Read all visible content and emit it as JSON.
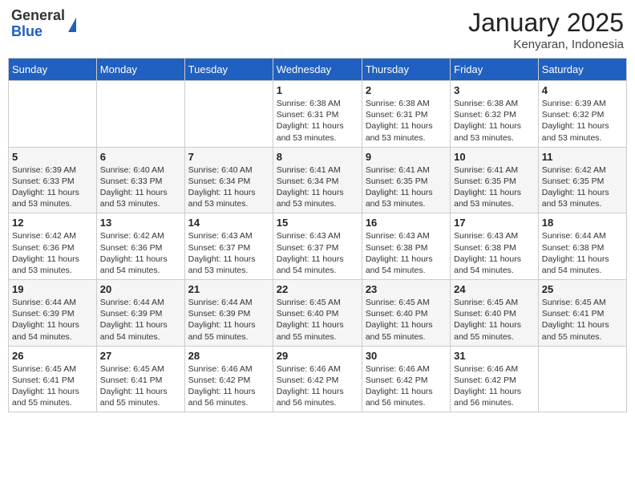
{
  "header": {
    "logo_general": "General",
    "logo_blue": "Blue",
    "month_title": "January 2025",
    "location": "Kenyaran, Indonesia"
  },
  "days_of_week": [
    "Sunday",
    "Monday",
    "Tuesday",
    "Wednesday",
    "Thursday",
    "Friday",
    "Saturday"
  ],
  "weeks": [
    [
      {
        "day": "",
        "info": ""
      },
      {
        "day": "",
        "info": ""
      },
      {
        "day": "",
        "info": ""
      },
      {
        "day": "1",
        "sunrise": "6:38 AM",
        "sunset": "6:31 PM",
        "daylight": "11 hours and 53 minutes."
      },
      {
        "day": "2",
        "sunrise": "6:38 AM",
        "sunset": "6:31 PM",
        "daylight": "11 hours and 53 minutes."
      },
      {
        "day": "3",
        "sunrise": "6:38 AM",
        "sunset": "6:32 PM",
        "daylight": "11 hours and 53 minutes."
      },
      {
        "day": "4",
        "sunrise": "6:39 AM",
        "sunset": "6:32 PM",
        "daylight": "11 hours and 53 minutes."
      }
    ],
    [
      {
        "day": "5",
        "sunrise": "6:39 AM",
        "sunset": "6:33 PM",
        "daylight": "11 hours and 53 minutes."
      },
      {
        "day": "6",
        "sunrise": "6:40 AM",
        "sunset": "6:33 PM",
        "daylight": "11 hours and 53 minutes."
      },
      {
        "day": "7",
        "sunrise": "6:40 AM",
        "sunset": "6:34 PM",
        "daylight": "11 hours and 53 minutes."
      },
      {
        "day": "8",
        "sunrise": "6:41 AM",
        "sunset": "6:34 PM",
        "daylight": "11 hours and 53 minutes."
      },
      {
        "day": "9",
        "sunrise": "6:41 AM",
        "sunset": "6:35 PM",
        "daylight": "11 hours and 53 minutes."
      },
      {
        "day": "10",
        "sunrise": "6:41 AM",
        "sunset": "6:35 PM",
        "daylight": "11 hours and 53 minutes."
      },
      {
        "day": "11",
        "sunrise": "6:42 AM",
        "sunset": "6:35 PM",
        "daylight": "11 hours and 53 minutes."
      }
    ],
    [
      {
        "day": "12",
        "sunrise": "6:42 AM",
        "sunset": "6:36 PM",
        "daylight": "11 hours and 53 minutes."
      },
      {
        "day": "13",
        "sunrise": "6:42 AM",
        "sunset": "6:36 PM",
        "daylight": "11 hours and 54 minutes."
      },
      {
        "day": "14",
        "sunrise": "6:43 AM",
        "sunset": "6:37 PM",
        "daylight": "11 hours and 53 minutes."
      },
      {
        "day": "15",
        "sunrise": "6:43 AM",
        "sunset": "6:37 PM",
        "daylight": "11 hours and 54 minutes."
      },
      {
        "day": "16",
        "sunrise": "6:43 AM",
        "sunset": "6:38 PM",
        "daylight": "11 hours and 54 minutes."
      },
      {
        "day": "17",
        "sunrise": "6:43 AM",
        "sunset": "6:38 PM",
        "daylight": "11 hours and 54 minutes."
      },
      {
        "day": "18",
        "sunrise": "6:44 AM",
        "sunset": "6:38 PM",
        "daylight": "11 hours and 54 minutes."
      }
    ],
    [
      {
        "day": "19",
        "sunrise": "6:44 AM",
        "sunset": "6:39 PM",
        "daylight": "11 hours and 54 minutes."
      },
      {
        "day": "20",
        "sunrise": "6:44 AM",
        "sunset": "6:39 PM",
        "daylight": "11 hours and 54 minutes."
      },
      {
        "day": "21",
        "sunrise": "6:44 AM",
        "sunset": "6:39 PM",
        "daylight": "11 hours and 55 minutes."
      },
      {
        "day": "22",
        "sunrise": "6:45 AM",
        "sunset": "6:40 PM",
        "daylight": "11 hours and 55 minutes."
      },
      {
        "day": "23",
        "sunrise": "6:45 AM",
        "sunset": "6:40 PM",
        "daylight": "11 hours and 55 minutes."
      },
      {
        "day": "24",
        "sunrise": "6:45 AM",
        "sunset": "6:40 PM",
        "daylight": "11 hours and 55 minutes."
      },
      {
        "day": "25",
        "sunrise": "6:45 AM",
        "sunset": "6:41 PM",
        "daylight": "11 hours and 55 minutes."
      }
    ],
    [
      {
        "day": "26",
        "sunrise": "6:45 AM",
        "sunset": "6:41 PM",
        "daylight": "11 hours and 55 minutes."
      },
      {
        "day": "27",
        "sunrise": "6:45 AM",
        "sunset": "6:41 PM",
        "daylight": "11 hours and 55 minutes."
      },
      {
        "day": "28",
        "sunrise": "6:46 AM",
        "sunset": "6:42 PM",
        "daylight": "11 hours and 56 minutes."
      },
      {
        "day": "29",
        "sunrise": "6:46 AM",
        "sunset": "6:42 PM",
        "daylight": "11 hours and 56 minutes."
      },
      {
        "day": "30",
        "sunrise": "6:46 AM",
        "sunset": "6:42 PM",
        "daylight": "11 hours and 56 minutes."
      },
      {
        "day": "31",
        "sunrise": "6:46 AM",
        "sunset": "6:42 PM",
        "daylight": "11 hours and 56 minutes."
      },
      {
        "day": "",
        "info": ""
      }
    ]
  ],
  "labels": {
    "sunrise": "Sunrise:",
    "sunset": "Sunset:",
    "daylight": "Daylight:"
  }
}
